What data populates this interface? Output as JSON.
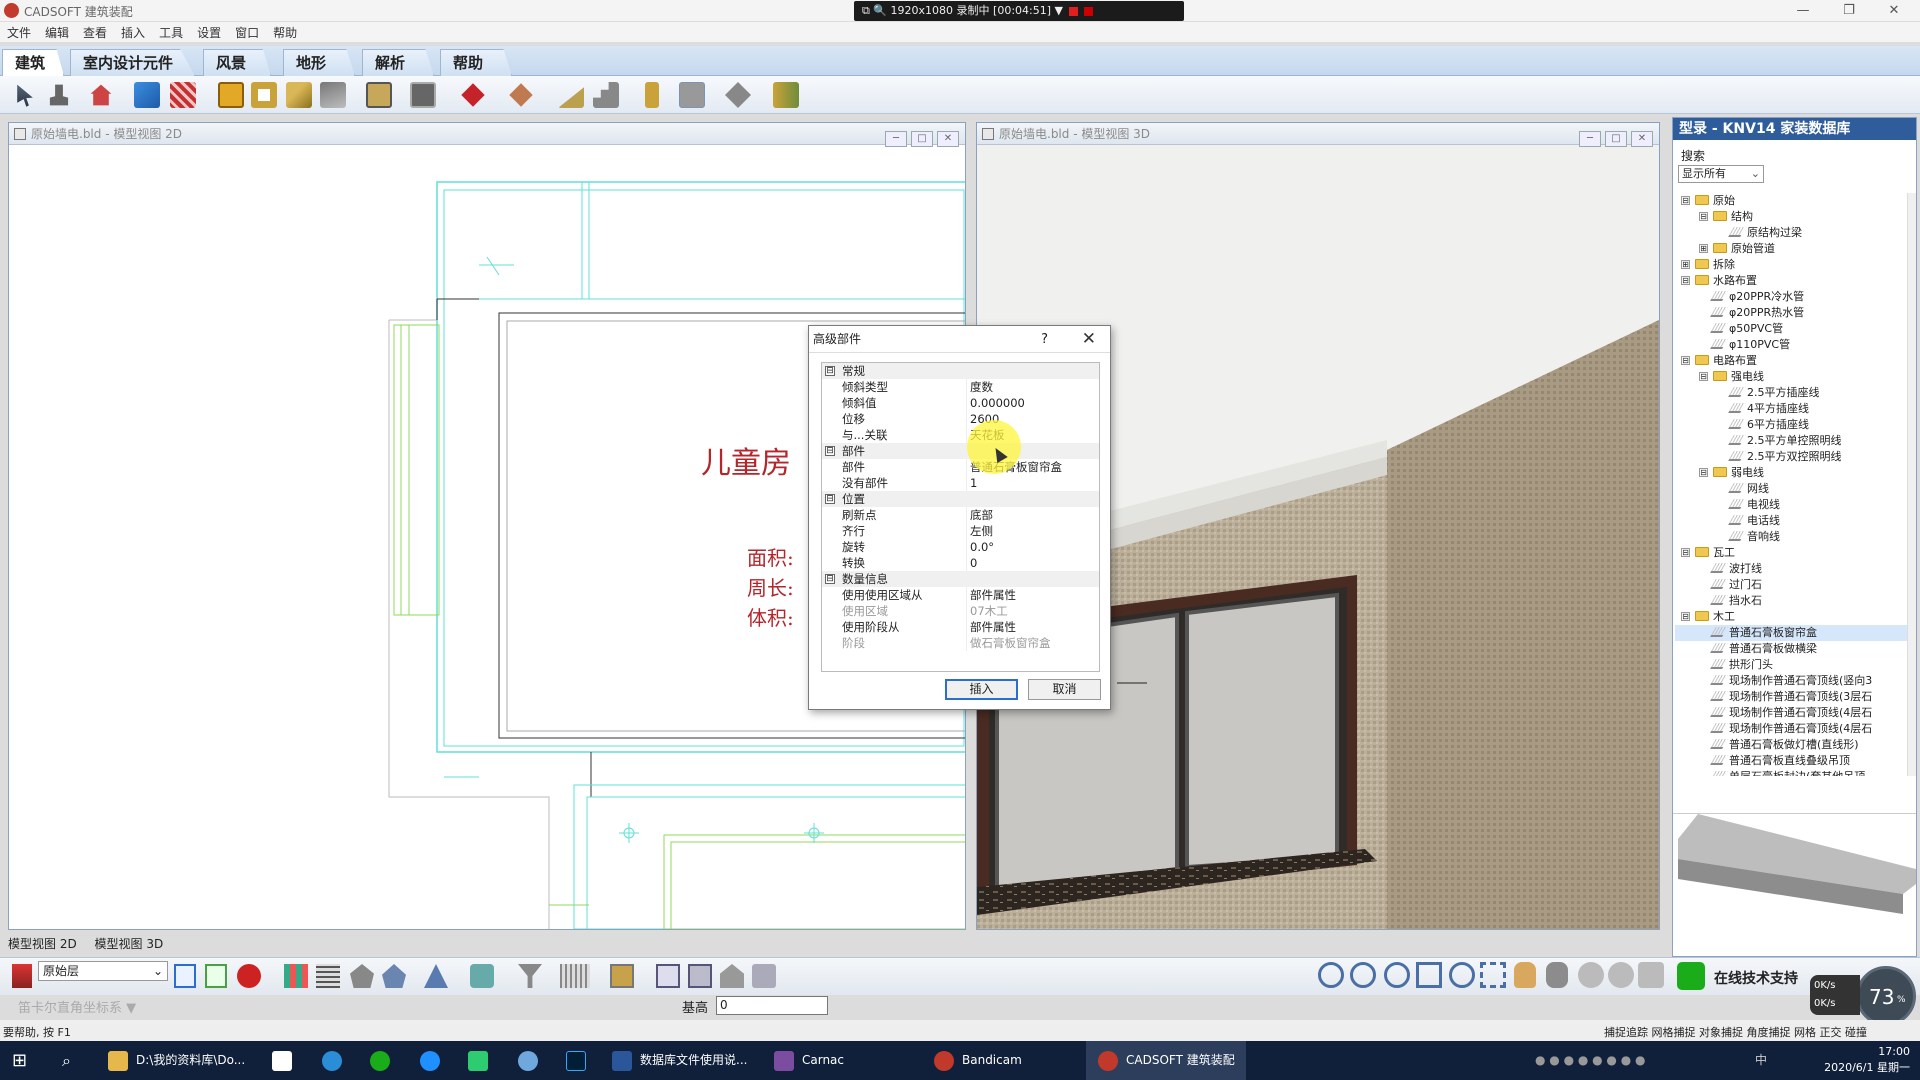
{
  "window": {
    "title": "CADSOFT 建筑装配",
    "minimize": "—",
    "restore": "❐",
    "close": "✕"
  },
  "recorder": {
    "text": "⧉ 🔍 1920x1080   录制中 [00:04:51]  ▼"
  },
  "menu": [
    "文件",
    "编辑",
    "查看",
    "插入",
    "工具",
    "设置",
    "窗口",
    "帮助"
  ],
  "tabs": [
    "建筑",
    "室内设计元件",
    "风景",
    "地形",
    "解析",
    "帮助"
  ],
  "pane2d": {
    "title": "原始墙电.bld - 模型视图 2D",
    "room_name": "儿童房",
    "area_label": "面积:",
    "perim_label": "周长:",
    "vol_label": "体积:"
  },
  "pane3d": {
    "title": "原始墙电.bld - 模型视图 3D"
  },
  "dialog": {
    "title": "高级部件",
    "help": "?",
    "close": "✕",
    "rows": [
      {
        "type": "cat",
        "k": "常规",
        "tog": "⊟"
      },
      {
        "k": "倾斜类型",
        "v": "度数"
      },
      {
        "k": "倾斜值",
        "v": "0.000000"
      },
      {
        "k": "位移",
        "v": "2600"
      },
      {
        "k": "与...关联",
        "v": "天花板"
      },
      {
        "type": "cat",
        "k": "部件",
        "tog": "⊟"
      },
      {
        "k": "部件",
        "v": "普通石膏板窗帘盒"
      },
      {
        "k": "没有部件",
        "v": "1"
      },
      {
        "type": "cat",
        "k": "位置",
        "tog": "⊟"
      },
      {
        "k": "刷新点",
        "v": "底部"
      },
      {
        "k": "齐行",
        "v": "左侧"
      },
      {
        "k": "旋转",
        "v": "0.0°"
      },
      {
        "k": "转换",
        "v": "0"
      },
      {
        "type": "cat",
        "k": "数量信息",
        "tog": "⊟"
      },
      {
        "k": "使用使用区域从",
        "v": "部件属性"
      },
      {
        "k": "使用区域",
        "v": "07木工",
        "dim": true
      },
      {
        "k": "使用阶段从",
        "v": "部件属性"
      },
      {
        "k": "阶段",
        "v": "做石膏板窗帘盒",
        "dim": true
      }
    ],
    "insert": "插入",
    "cancel": "取消"
  },
  "catalog": {
    "title": "型录 - KNV14 家装数据库",
    "search_label": "搜索",
    "filter": "显示所有",
    "tree": [
      {
        "d": 0,
        "t": "f",
        "l": "原始",
        "tg": "⊟"
      },
      {
        "d": 1,
        "t": "f",
        "l": "结构",
        "tg": "⊟"
      },
      {
        "d": 2,
        "t": "i",
        "l": "原结构过梁"
      },
      {
        "d": 1,
        "t": "f",
        "l": "原始管道",
        "tg": "⊞"
      },
      {
        "d": 0,
        "t": "f",
        "l": "拆除",
        "tg": "⊞"
      },
      {
        "d": 0,
        "t": "f",
        "l": "水路布置",
        "tg": "⊟"
      },
      {
        "d": 1,
        "t": "i",
        "l": "φ20PPR冷水管"
      },
      {
        "d": 1,
        "t": "i",
        "l": "φ20PPR热水管"
      },
      {
        "d": 1,
        "t": "i",
        "l": "φ50PVC管"
      },
      {
        "d": 1,
        "t": "i",
        "l": "φ110PVC管"
      },
      {
        "d": 0,
        "t": "f",
        "l": "电路布置",
        "tg": "⊟"
      },
      {
        "d": 1,
        "t": "f",
        "l": "强电线",
        "tg": "⊟"
      },
      {
        "d": 2,
        "t": "i",
        "l": "2.5平方插座线"
      },
      {
        "d": 2,
        "t": "i",
        "l": "4平方插座线"
      },
      {
        "d": 2,
        "t": "i",
        "l": "6平方插座线"
      },
      {
        "d": 2,
        "t": "i",
        "l": "2.5平方单控照明线"
      },
      {
        "d": 2,
        "t": "i",
        "l": "2.5平方双控照明线"
      },
      {
        "d": 1,
        "t": "f",
        "l": "弱电线",
        "tg": "⊟"
      },
      {
        "d": 2,
        "t": "i",
        "l": "网线"
      },
      {
        "d": 2,
        "t": "i",
        "l": "电视线"
      },
      {
        "d": 2,
        "t": "i",
        "l": "电话线"
      },
      {
        "d": 2,
        "t": "i",
        "l": "音响线"
      },
      {
        "d": 0,
        "t": "f",
        "l": "瓦工",
        "tg": "⊟"
      },
      {
        "d": 1,
        "t": "i",
        "l": "波打线"
      },
      {
        "d": 1,
        "t": "i",
        "l": "过门石"
      },
      {
        "d": 1,
        "t": "i",
        "l": "挡水石"
      },
      {
        "d": 0,
        "t": "f",
        "l": "木工",
        "tg": "⊟"
      },
      {
        "d": 1,
        "t": "i",
        "l": "普通石膏板窗帘盒",
        "sel": true
      },
      {
        "d": 1,
        "t": "i",
        "l": "普通石膏板做横梁"
      },
      {
        "d": 1,
        "t": "i",
        "l": "拱形门头"
      },
      {
        "d": 1,
        "t": "i",
        "l": "现场制作普通石膏顶线(竖向3"
      },
      {
        "d": 1,
        "t": "i",
        "l": "现场制作普通石膏顶线(3层石"
      },
      {
        "d": 1,
        "t": "i",
        "l": "现场制作普通石膏顶线(4层石"
      },
      {
        "d": 1,
        "t": "i",
        "l": "现场制作普通石膏顶线(4层石"
      },
      {
        "d": 1,
        "t": "i",
        "l": "普通石膏板做灯槽(直线形)"
      },
      {
        "d": 1,
        "t": "i",
        "l": "普通石膏板直线叠级吊顶"
      },
      {
        "d": 1,
        "t": "i",
        "l": "单层石膏板封边(套其他吊顶"
      }
    ]
  },
  "viewtabs": [
    "模型视图 2D",
    "模型视图 3D"
  ],
  "layer": "原始层",
  "support": "在线技术支持",
  "speed": {
    "pct": "73",
    "unit": "%",
    "up": "0K/s",
    "down": "0K/s"
  },
  "coord": "笛卡尔直角坐标系 ▼",
  "base_label": "基高",
  "base_value": "0",
  "status_left": "要帮助, 按 F1",
  "status_right": "捕捉追踪  网格捕捉  对象捕捉  角度捕捉  网格  正交  碰撞",
  "taskbar": {
    "items": [
      "D:\\我的资料库\\Do...",
      "数据库文件使用说...",
      "Carnac",
      "Bandicam",
      "CADSOFT 建筑装配"
    ],
    "time": "17:00",
    "date": "2020/6/1 星期一",
    "tray": "中"
  }
}
